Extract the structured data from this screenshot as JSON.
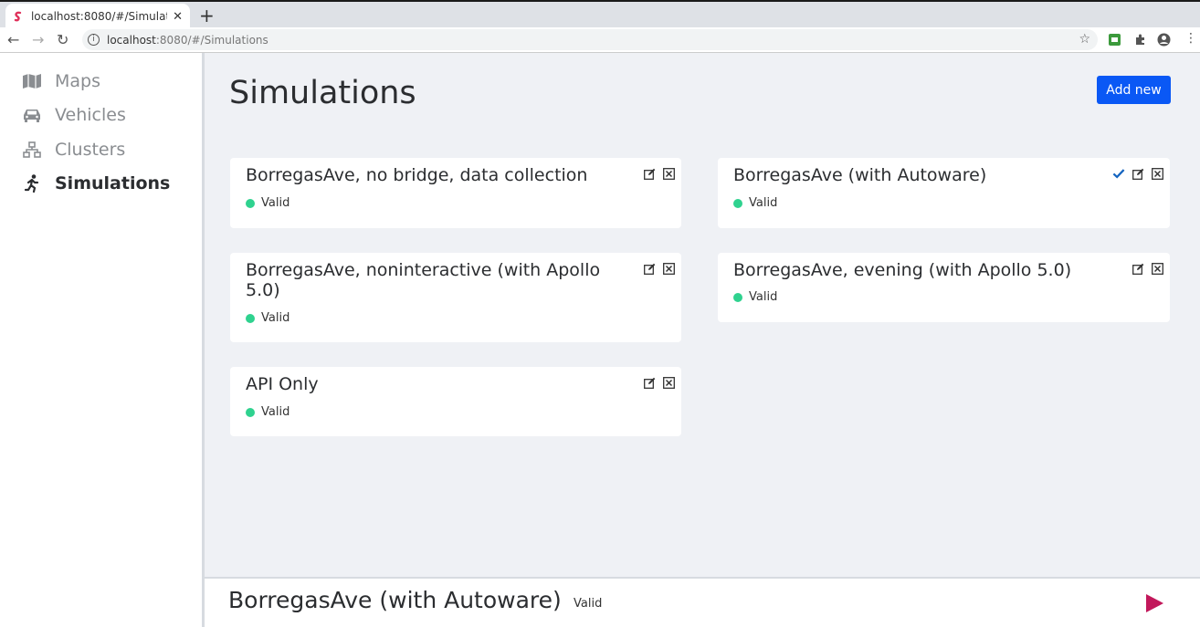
{
  "browser": {
    "tab_title": "localhost:8080/#/Simulati",
    "url_host": "localhost",
    "url_rest": ":8080/#/Simulations"
  },
  "sidebar": {
    "items": [
      {
        "label": "Maps",
        "icon": "map-icon"
      },
      {
        "label": "Vehicles",
        "icon": "car-icon"
      },
      {
        "label": "Clusters",
        "icon": "cluster-icon"
      },
      {
        "label": "Simulations",
        "icon": "running-person-icon",
        "active": true
      }
    ]
  },
  "main": {
    "title": "Simulations",
    "add_button": "Add new"
  },
  "cards": [
    {
      "title": "BorregasAve, no bridge, data collection",
      "status": "Valid"
    },
    {
      "title": "BorregasAve (with Autoware)",
      "status": "Valid",
      "selected": true
    },
    {
      "title": "BorregasAve, noninteractive (with Apollo 5.0)",
      "status": "Valid"
    },
    {
      "title": "BorregasAve, evening (with Apollo 5.0)",
      "status": "Valid"
    },
    {
      "title": "API Only",
      "status": "Valid"
    }
  ],
  "bottom_bar": {
    "selected_title": "BorregasAve (with Autoware)",
    "selected_status": "Valid"
  },
  "colors": {
    "accent": "#0a58f5",
    "valid": "#2fd28f",
    "play": "#c2185b",
    "check": "#1565c0"
  }
}
